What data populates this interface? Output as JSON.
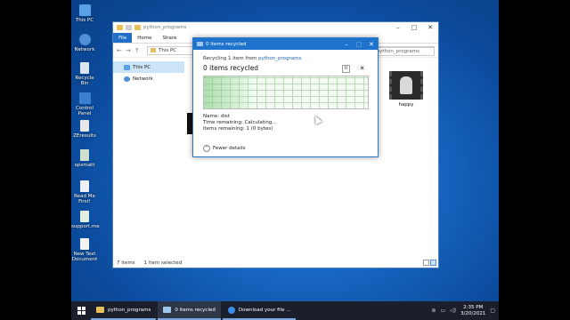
{
  "desktop": {
    "icons": [
      {
        "label": "This PC",
        "color": "#5aa0e6"
      },
      {
        "label": "Network",
        "color": "#4f8fd6"
      },
      {
        "label": "Recycle Bin",
        "color": "#dbe6f0"
      },
      {
        "label": "Control Panel",
        "color": "#3b7fd0"
      },
      {
        "label": "ZEresults",
        "color": "#e8e8e8"
      },
      {
        "label": "opsmatt",
        "color": "#cfe0cf"
      },
      {
        "label": "Read Me First!",
        "color": "#eef2f6"
      },
      {
        "label": "support.me",
        "color": "#e0efe0"
      },
      {
        "label": "New Text Document",
        "color": "#f3f3f3"
      }
    ]
  },
  "explorer": {
    "title": "python_programs",
    "ribbon_tabs": [
      "File",
      "Home",
      "Share"
    ],
    "address": "This PC",
    "search_placeholder": "Search python_programs",
    "nav_items": [
      {
        "label": "This PC",
        "selected": true,
        "icon": "computer-icon"
      },
      {
        "label": "Network",
        "selected": false,
        "icon": "network-icon"
      }
    ],
    "file_happy": "happy",
    "status_items": "7 items",
    "status_selected": "1 item selected"
  },
  "dialog": {
    "title": "0 items recycled",
    "subtitle_prefix": "Recycling 1 item from ",
    "subtitle_link": "python_programs",
    "heading": "0 items recycled",
    "pause_symbol": "II",
    "cancel_symbol": "✕",
    "name_line": "Name:  dist",
    "time_line": "Time remaining:  Calculating...",
    "items_line": "Items remaining:  1 (0 bytes)",
    "fewer_details": "Fewer details",
    "progress": 0.0
  },
  "taskbar": {
    "items": [
      {
        "label": "python_programs",
        "icon_color": "#e7c05a",
        "active": false
      },
      {
        "label": "0 items recycled",
        "icon_color": "#9fc7ee",
        "active": true
      },
      {
        "label": "Download your file ...",
        "icon_color": "#3a8ee8",
        "active": false
      }
    ],
    "time": "2:35 PM",
    "date": "3/20/2021"
  }
}
